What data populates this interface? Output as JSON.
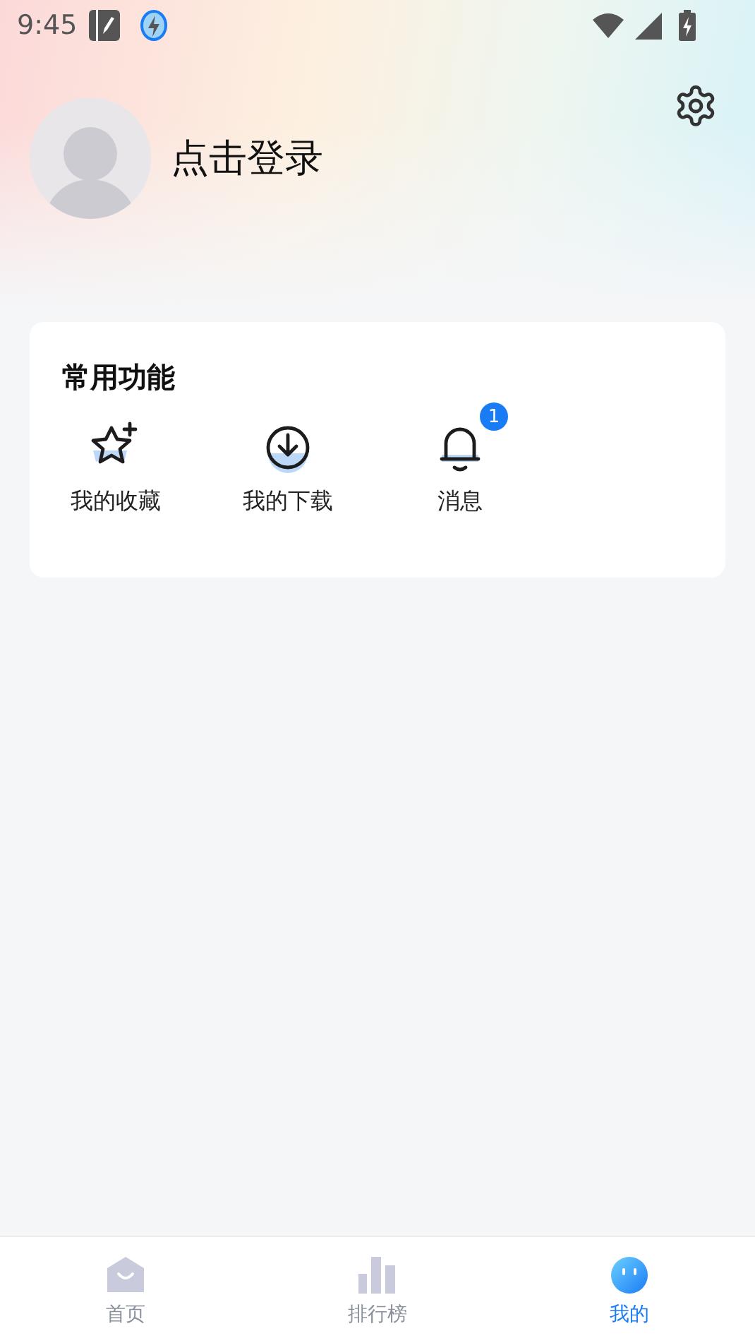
{
  "status_bar": {
    "time": "9:45"
  },
  "profile": {
    "login_label": "点击登录"
  },
  "common_functions": {
    "title": "常用功能",
    "items": [
      {
        "kind": "star",
        "label": "我的收藏"
      },
      {
        "kind": "download",
        "label": "我的下载"
      },
      {
        "kind": "bell",
        "label": "消息",
        "badge": "1"
      }
    ]
  },
  "tab_bar": [
    {
      "kind": "home",
      "label": "首页",
      "selected": false
    },
    {
      "kind": "chart",
      "label": "排行榜",
      "selected": false
    },
    {
      "kind": "face",
      "label": "我的",
      "selected": true
    }
  ]
}
